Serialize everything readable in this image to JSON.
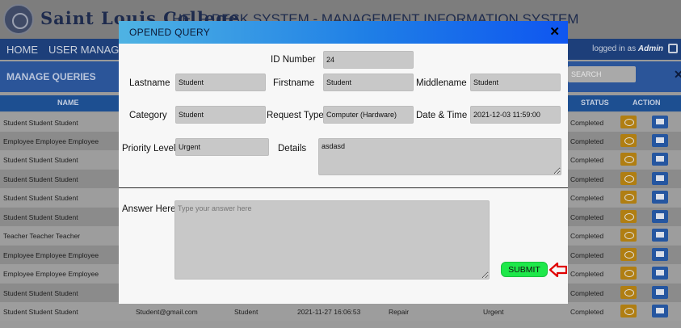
{
  "header": {
    "college_name": "Saint Louis College",
    "system_title": "HELP DESK SYSTEM - MANAGEMENT INFORMATION SYSTEM"
  },
  "nav": {
    "home": "HOME",
    "user_manage": "USER MANAGE",
    "logged_in_prefix": "logged in as",
    "user": "Admin"
  },
  "subheader": {
    "title": "MANAGE QUERIES",
    "search_placeholder": "SEARCH",
    "close": "✕"
  },
  "table": {
    "headers": {
      "name": "NAME",
      "status": "STATUS",
      "action": "ACTION"
    },
    "rows": [
      {
        "name": "Student Student Student",
        "status": "Completed"
      },
      {
        "name": "Employee Employee Employee",
        "status": "Completed"
      },
      {
        "name": "Student Student Student",
        "status": "Completed"
      },
      {
        "name": "Student Student Student",
        "status": "Completed"
      },
      {
        "name": "Student Student Student",
        "status": "Completed"
      },
      {
        "name": "Student Student Student",
        "status": "Completed"
      },
      {
        "name": "Teacher Teacher Teacher",
        "status": "Completed"
      },
      {
        "name": "Employee Employee Employee",
        "status": "Completed"
      },
      {
        "name": "Employee Employee Employee",
        "status": "Completed"
      },
      {
        "name": "Student Student Student",
        "status": "Completed"
      },
      {
        "name": "Student Student Student",
        "email": "Student@gmail.com",
        "category": "Student",
        "datetime": "2021-11-27 16:06:53",
        "request": "Repair",
        "priority": "Urgent",
        "status": "Completed"
      }
    ]
  },
  "modal": {
    "title": "OPENED QUERY",
    "close": "✕",
    "id_label": "ID Number",
    "id_value": "24",
    "lastname_label": "Lastname",
    "lastname_value": "Student",
    "firstname_label": "Firstname",
    "firstname_value": "Student",
    "middlename_label": "Middlename",
    "middlename_value": "Student",
    "category_label": "Category",
    "category_value": "Student",
    "request_type_label": "Request Type",
    "request_type_value": "Computer (Hardware)",
    "datetime_label": "Date & Time",
    "datetime_value": "2021-12-03 11:59:00",
    "priority_label": "Priority Level",
    "priority_value": "Urgent",
    "details_label": "Details",
    "details_value": "asdasd",
    "answer_label": "Answer Here",
    "answer_placeholder": "Type your answer here",
    "submit_label": "SUBMIT",
    "arrow_color": "#e00000"
  },
  "icons": [
    "college-logo-icon",
    "logout-icon",
    "view-icon",
    "message-icon",
    "close-icon",
    "arrow-left-icon"
  ]
}
